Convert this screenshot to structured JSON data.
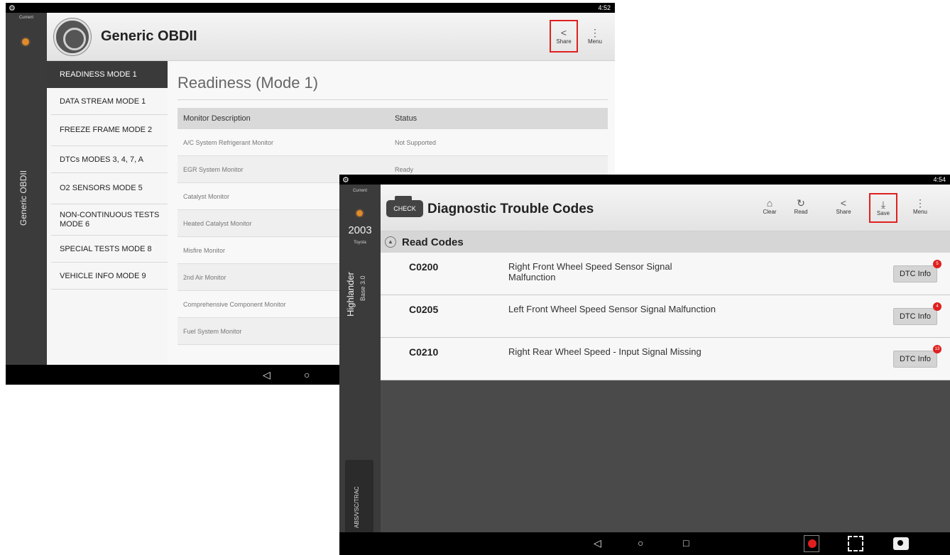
{
  "screen1": {
    "status": {
      "time": "4:52"
    },
    "rail": {
      "current_label": "Current",
      "vehicle_label": "Generic OBDII"
    },
    "header": {
      "title": "Generic OBDII",
      "buttons": {
        "share": "Share",
        "menu": "Menu"
      }
    },
    "sidebar": {
      "items": [
        {
          "label": "READINESS MODE 1",
          "active": true
        },
        {
          "label": "DATA STREAM MODE 1"
        },
        {
          "label": "FREEZE FRAME MODE 2"
        },
        {
          "label": "DTCs MODES 3, 4, 7, A"
        },
        {
          "label": "O2 SENSORS MODE 5"
        },
        {
          "label": "NON-CONTINUOUS TESTS MODE 6"
        },
        {
          "label": "SPECIAL TESTS MODE 8"
        },
        {
          "label": "VEHICLE INFO MODE 9"
        }
      ]
    },
    "main": {
      "title": "Readiness (Mode 1)",
      "columns": [
        "Monitor Description",
        "Status"
      ],
      "rows": [
        {
          "monitor": "A/C System Refrigerant Monitor",
          "status": "Not Supported"
        },
        {
          "monitor": "EGR System Monitor",
          "status": "Ready"
        },
        {
          "monitor": "Catalyst Monitor",
          "status": ""
        },
        {
          "monitor": "Heated Catalyst Monitor",
          "status": ""
        },
        {
          "monitor": "Misfire Monitor",
          "status": ""
        },
        {
          "monitor": "2nd Air Monitor",
          "status": ""
        },
        {
          "monitor": "Comprehensive Component Monitor",
          "status": ""
        },
        {
          "monitor": "Fuel System Monitor",
          "status": ""
        }
      ]
    }
  },
  "screen2": {
    "status": {
      "time": "4:54"
    },
    "rail": {
      "current_label": "Current",
      "year": "2003",
      "make": "Toyota",
      "model": "Highlander",
      "trim": "Base 3.0",
      "system": "ABS/VSC/TRAC"
    },
    "header": {
      "check_label": "CHECK",
      "title": "Diagnostic Trouble Codes",
      "buttons": {
        "clear": "Clear",
        "read": "Read",
        "share": "Share",
        "save": "Save",
        "menu": "Menu"
      }
    },
    "section": {
      "label": "Read Codes"
    },
    "codes": [
      {
        "code": "C0200",
        "description": "Right Front Wheel Speed Sensor Signal Malfunction",
        "button": "DTC Info",
        "badge": "5"
      },
      {
        "code": "C0205",
        "description": "Left Front Wheel Speed Sensor Signal Malfunction",
        "button": "DTC Info",
        "badge": "4"
      },
      {
        "code": "C0210",
        "description": "Right Rear Wheel Speed - Input Signal Missing",
        "button": "DTC Info",
        "badge": "13"
      }
    ]
  },
  "icons": {
    "gear": "⚙",
    "share": "<",
    "menu": "⋮",
    "clear": "⌂",
    "read": "↻",
    "save": "⤓",
    "back": "◁",
    "home": "○",
    "recents": "□"
  },
  "colors": {
    "highlight": "#e0201f",
    "accent_dot": "#e08a2c",
    "rail": "#3b3b3b"
  }
}
